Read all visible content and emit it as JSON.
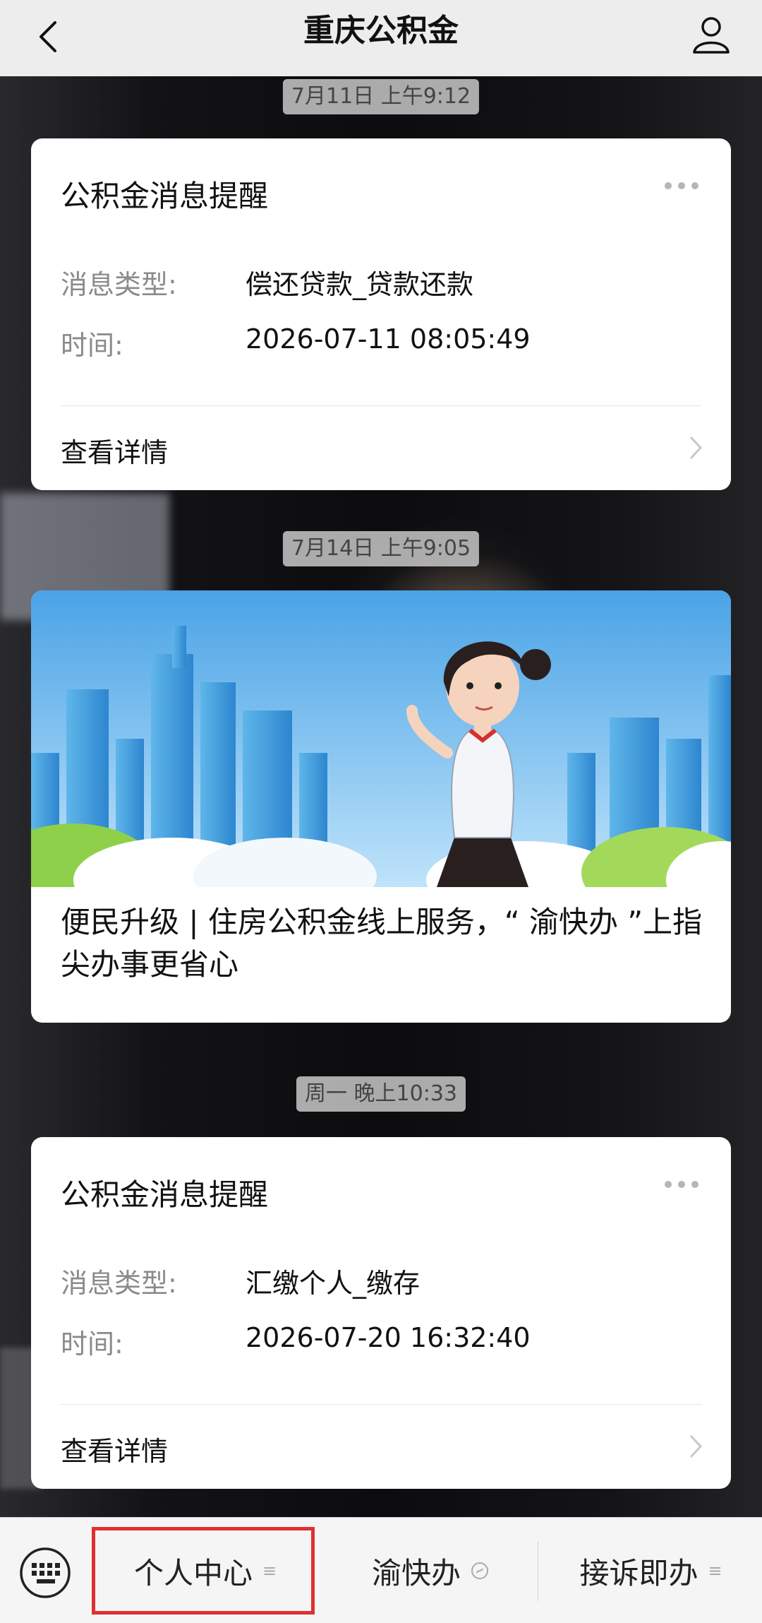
{
  "header": {
    "title": "重庆公积金"
  },
  "messages": [
    {
      "timestamp": "7月11日 上午9:12",
      "card_title": "公积金消息提醒",
      "type_label": "消息类型:",
      "type_value": "偿还贷款_贷款还款",
      "time_label": "时间:",
      "time_value": "2026-07-11 08:05:49",
      "detail_label": "查看详情"
    },
    {
      "timestamp": "7月14日 上午9:05",
      "headline": "便民升级 | 住房公积金线上服务，“ 渝快办 ”上指尖办事更省心"
    },
    {
      "timestamp": "周一 晚上10:33",
      "card_title": "公积金消息提醒",
      "type_label": "消息类型:",
      "type_value": "汇缴个人_缴存",
      "time_label": "时间:",
      "time_value": "2026-07-20 16:32:40",
      "detail_label": "查看详情"
    }
  ],
  "bottom_menu": {
    "items": [
      {
        "label": "个人中心",
        "icon": "menu-lines-icon"
      },
      {
        "label": "渝快办",
        "icon": "mini-program-icon"
      },
      {
        "label": "接诉即办",
        "icon": "menu-lines-icon"
      }
    ]
  },
  "colors": {
    "highlight": "#e03030"
  }
}
